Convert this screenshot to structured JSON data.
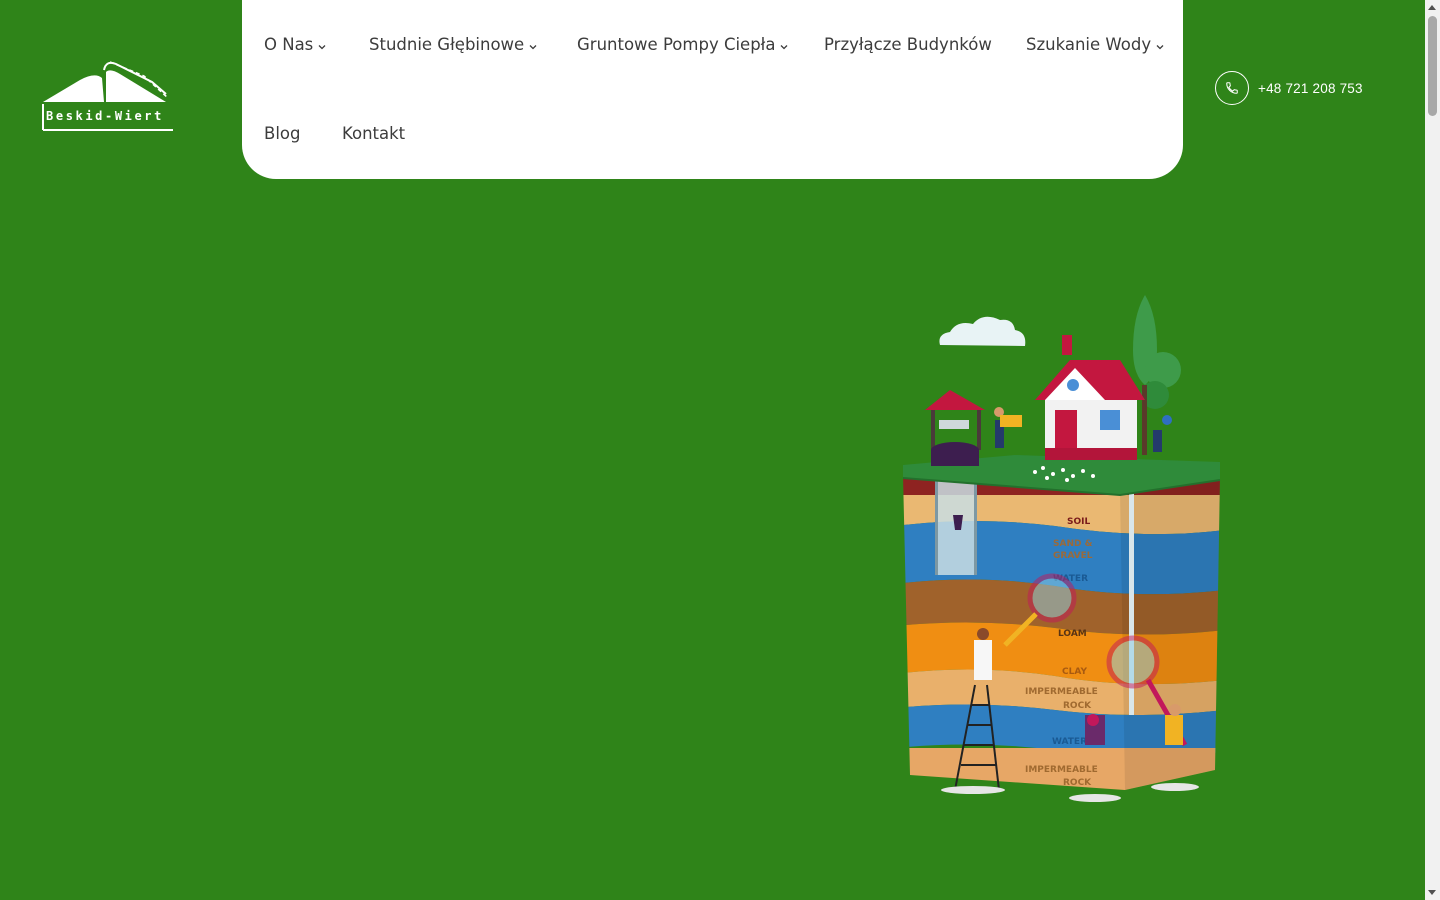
{
  "brand": {
    "name": "Beskid-Wiert"
  },
  "nav": {
    "items": [
      {
        "label": "O Nas",
        "has_dropdown": true
      },
      {
        "label": "Studnie Głębinowe",
        "has_dropdown": true
      },
      {
        "label": "Gruntowe Pompy Ciepła",
        "has_dropdown": true
      },
      {
        "label": "Przyłącze Budynków",
        "has_dropdown": false
      },
      {
        "label": "Szukanie Wody",
        "has_dropdown": true
      },
      {
        "label": "Blog",
        "has_dropdown": false
      },
      {
        "label": "Kontakt",
        "has_dropdown": false
      }
    ]
  },
  "contact": {
    "phone": "+48 721 208 753",
    "icon": "phone-icon"
  },
  "hero": {
    "illustration": "groundwater-layers-illustration",
    "layer_labels": [
      "SOIL",
      "SAND &",
      "GRAVEL",
      "WATER",
      "LOAM",
      "CLAY",
      "IMPERMEABLE",
      "ROCK",
      "WATER",
      "IMPERMEABLE",
      "ROCK"
    ]
  },
  "colors": {
    "background": "#2f8419",
    "nav_bg": "#ffffff",
    "nav_text": "#3c3c3c",
    "accent": "#ffffff"
  }
}
